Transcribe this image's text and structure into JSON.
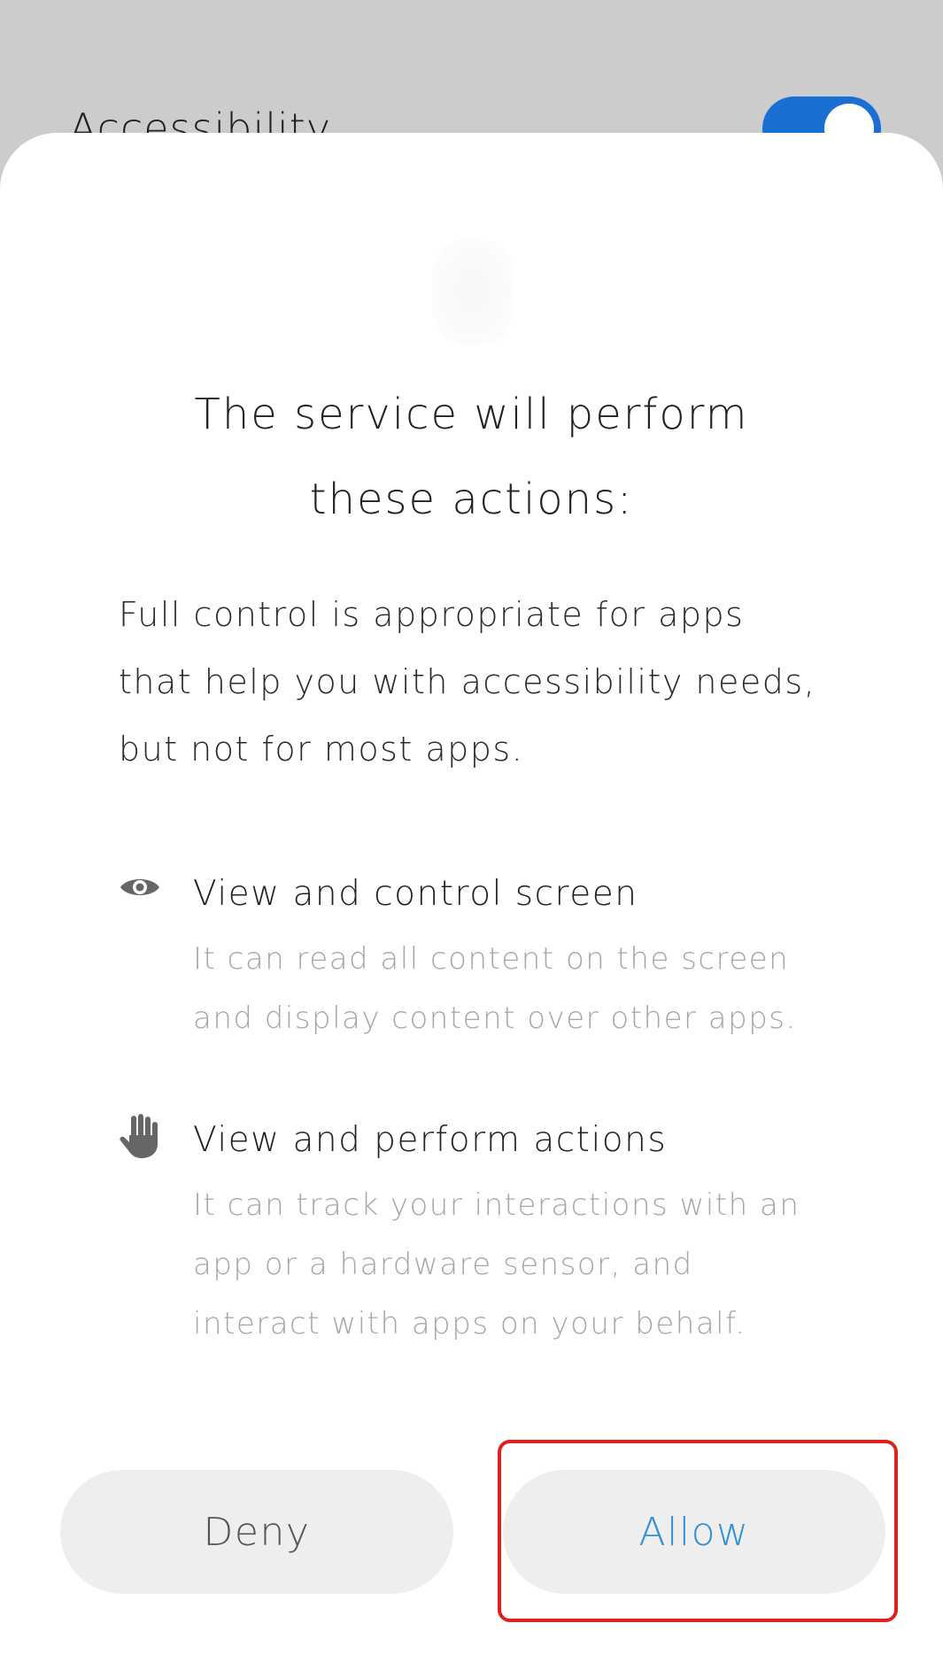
{
  "background": {
    "setting_label": "Accessibility",
    "toggle_on": true,
    "toggle_color": "#1a6fd3"
  },
  "dialog": {
    "title": "The service will perform these actions:",
    "intro": "Full control is appropriate for apps that help you with accessibility needs, but not for most apps.",
    "permissions": [
      {
        "icon": "eye-icon",
        "title": "View and control screen",
        "description": "It can read all content on the screen and display content over other apps."
      },
      {
        "icon": "hand-icon",
        "title": "View and perform actions",
        "description": "It can track your interactions with an app or a hardware sensor, and interact with apps on your behalf."
      }
    ],
    "buttons": {
      "deny": "Deny",
      "allow": "Allow"
    }
  },
  "colors": {
    "allow_text": "#2f8fd8",
    "highlight": "#e02020",
    "button_bg": "#eeeeee"
  }
}
